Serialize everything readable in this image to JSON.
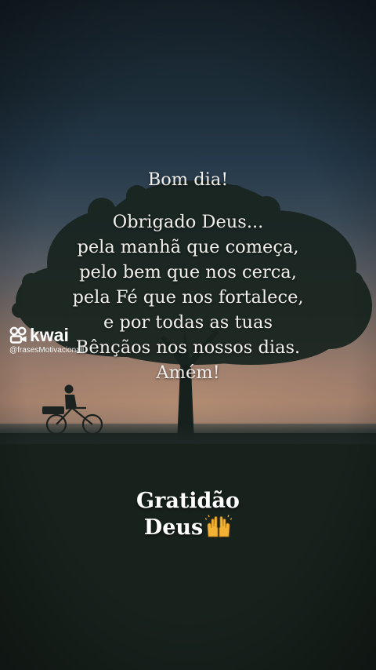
{
  "quote": {
    "greeting": "Bom dia!",
    "lines": [
      "Obrigado Deus...",
      "pela manhã que começa,",
      "pelo bem que nos cerca,",
      "pela Fé que nos fortalece,",
      "e por todas as tuas",
      "Bênçãos nos nossos dias.",
      "Amém!"
    ]
  },
  "watermark": {
    "brand": "kwai",
    "handle": "@frasesMotivacionall",
    "logo_icon": "kwai-logo-icon"
  },
  "caption": {
    "line1": "Gratidão",
    "line2": "Deus",
    "emoji": "raising-hands-emoji"
  },
  "colors": {
    "text": "#f2f0ec",
    "caption_emoji": "#f2b233"
  }
}
